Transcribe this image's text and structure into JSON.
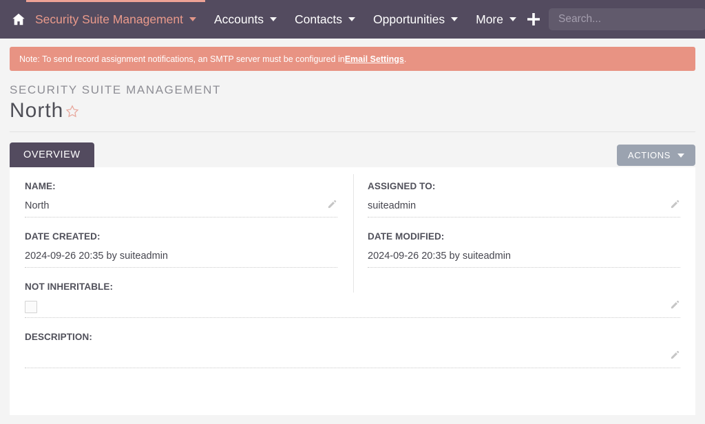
{
  "navbar": {
    "home_icon": "home-icon",
    "items": [
      {
        "label": "Security Suite Management",
        "active": true,
        "has_caret": true
      },
      {
        "label": "Accounts",
        "active": false,
        "has_caret": true
      },
      {
        "label": "Contacts",
        "active": false,
        "has_caret": true
      },
      {
        "label": "Opportunities",
        "active": false,
        "has_caret": true
      },
      {
        "label": "More",
        "active": false,
        "has_caret": true
      }
    ],
    "plus_icon": "plus-icon",
    "search": {
      "value": "",
      "placeholder": "Search..."
    },
    "background_color": "#534b5f",
    "active_color": "#ea9a8b"
  },
  "alert": {
    "text_before": "Note: To send record assignment notifications, an SMTP server must be configured in ",
    "link_text": "Email Settings",
    "text_after": ".",
    "background_color": "#e89383"
  },
  "page_head": {
    "module_title": "SECURITY SUITE MANAGEMENT",
    "record_title": "North",
    "favorite_icon": "star-outline-icon"
  },
  "tabs": [
    {
      "label": "OVERVIEW",
      "active": true
    }
  ],
  "actions": {
    "label": "ACTIONS",
    "caret_icon": "chevron-down-icon",
    "background_color": "#9ba3b0"
  },
  "fields": [
    {
      "label": "NAME:",
      "value": "North",
      "type": "text",
      "editable": true,
      "full_width": false
    },
    {
      "label": "ASSIGNED TO:",
      "value": "suiteadmin",
      "type": "text",
      "editable": true,
      "full_width": false
    },
    {
      "label": "DATE CREATED:",
      "value": "2024-09-26 20:35 by suiteadmin",
      "type": "text",
      "editable": false,
      "full_width": false
    },
    {
      "label": "DATE MODIFIED:",
      "value": "2024-09-26 20:35 by suiteadmin",
      "type": "text",
      "editable": false,
      "full_width": false
    },
    {
      "label": "NOT INHERITABLE:",
      "value": "",
      "type": "checkbox",
      "checked": false,
      "editable": true,
      "full_width": true
    },
    {
      "label": "DESCRIPTION:",
      "value": "",
      "type": "text",
      "editable": true,
      "full_width": true
    }
  ]
}
